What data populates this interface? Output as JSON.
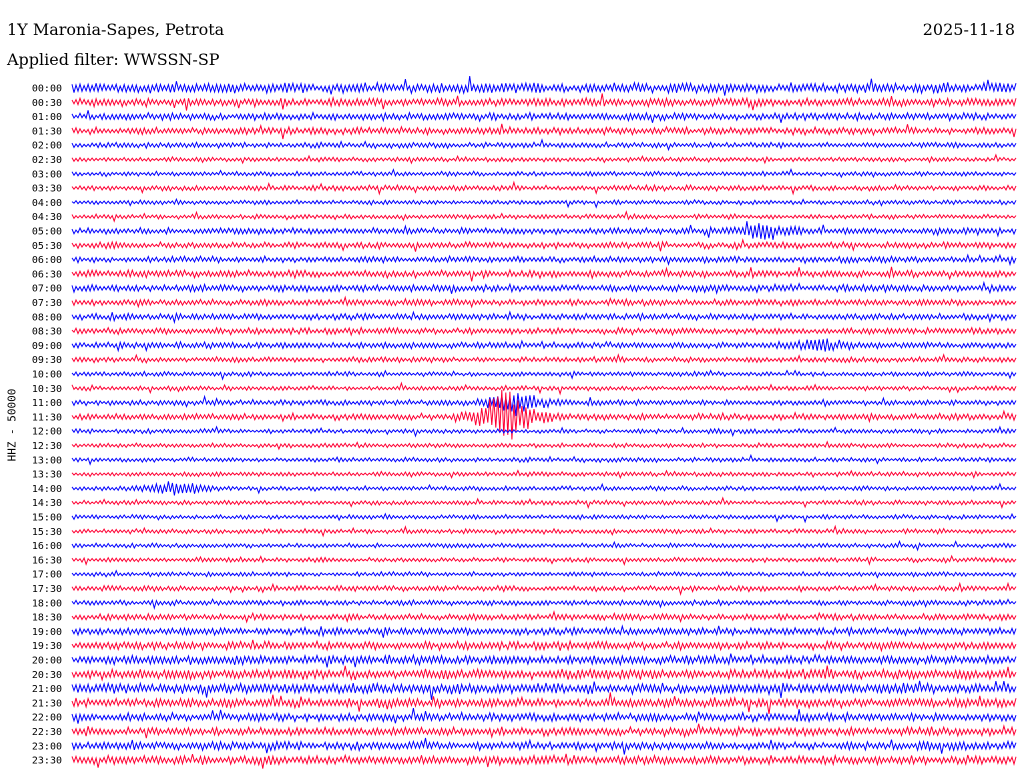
{
  "header": {
    "station": "1Y Maronia-Sapes, Petrota",
    "date": "2025-11-18",
    "filter": "Applied filter: WWSSN-SP"
  },
  "chart_data": {
    "type": "line",
    "ylabel": "HHZ - 50000",
    "tick_labels": [
      "00:00",
      "00:30",
      "01:00",
      "01:30",
      "02:00",
      "02:30",
      "03:00",
      "03:30",
      "04:00",
      "04:30",
      "05:00",
      "05:30",
      "06:00",
      "06:30",
      "07:00",
      "07:30",
      "08:00",
      "08:30",
      "09:00",
      "09:30",
      "10:00",
      "10:30",
      "11:00",
      "11:30",
      "12:00",
      "12:30",
      "13:00",
      "13:30",
      "14:00",
      "14:30",
      "15:00",
      "15:30",
      "16:00",
      "16:30",
      "17:00",
      "17:30",
      "18:00",
      "18:30",
      "19:00",
      "19:30",
      "20:00",
      "20:30",
      "21:00",
      "21:30",
      "22:00",
      "22:30",
      "23:00",
      "23:30"
    ],
    "trace_colors": [
      "#0000ff",
      "#ff0033"
    ],
    "row_minutes": 30,
    "row_amplitudes": [
      1.1,
      0.9,
      0.8,
      0.8,
      0.6,
      0.5,
      0.5,
      0.6,
      0.5,
      0.5,
      0.7,
      0.7,
      0.7,
      0.8,
      0.8,
      0.7,
      0.7,
      0.7,
      0.7,
      0.6,
      0.5,
      0.5,
      0.6,
      0.7,
      0.5,
      0.5,
      0.5,
      0.5,
      0.5,
      0.5,
      0.5,
      0.5,
      0.5,
      0.5,
      0.5,
      0.6,
      0.6,
      0.7,
      0.8,
      0.9,
      1.0,
      1.1,
      1.1,
      1.0,
      0.9,
      0.9,
      0.9,
      1.0
    ],
    "events": [
      {
        "row": 23,
        "time_fraction": 0.46,
        "peak": 6.0
      },
      {
        "row": 22,
        "time_fraction": 0.47,
        "peak": 2.5
      },
      {
        "row": 10,
        "time_fraction": 0.73,
        "peak": 2.0
      },
      {
        "row": 28,
        "time_fraction": 0.11,
        "peak": 1.6
      },
      {
        "row": 18,
        "time_fraction": 0.79,
        "peak": 1.4
      }
    ]
  }
}
